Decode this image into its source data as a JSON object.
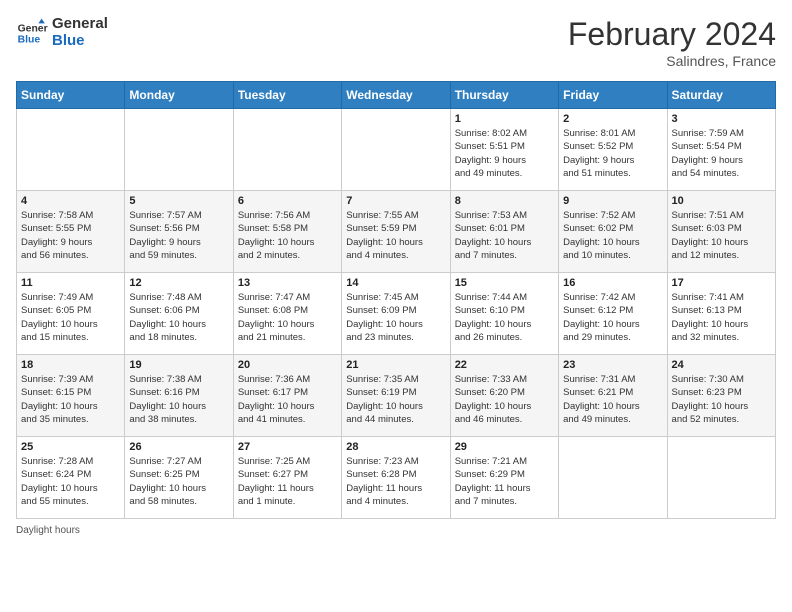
{
  "header": {
    "logo_line1": "General",
    "logo_line2": "Blue",
    "title": "February 2024",
    "location": "Salindres, France"
  },
  "days_of_week": [
    "Sunday",
    "Monday",
    "Tuesday",
    "Wednesday",
    "Thursday",
    "Friday",
    "Saturday"
  ],
  "weeks": [
    [
      {
        "day": "",
        "info": ""
      },
      {
        "day": "",
        "info": ""
      },
      {
        "day": "",
        "info": ""
      },
      {
        "day": "",
        "info": ""
      },
      {
        "day": "1",
        "info": "Sunrise: 8:02 AM\nSunset: 5:51 PM\nDaylight: 9 hours\nand 49 minutes."
      },
      {
        "day": "2",
        "info": "Sunrise: 8:01 AM\nSunset: 5:52 PM\nDaylight: 9 hours\nand 51 minutes."
      },
      {
        "day": "3",
        "info": "Sunrise: 7:59 AM\nSunset: 5:54 PM\nDaylight: 9 hours\nand 54 minutes."
      }
    ],
    [
      {
        "day": "4",
        "info": "Sunrise: 7:58 AM\nSunset: 5:55 PM\nDaylight: 9 hours\nand 56 minutes."
      },
      {
        "day": "5",
        "info": "Sunrise: 7:57 AM\nSunset: 5:56 PM\nDaylight: 9 hours\nand 59 minutes."
      },
      {
        "day": "6",
        "info": "Sunrise: 7:56 AM\nSunset: 5:58 PM\nDaylight: 10 hours\nand 2 minutes."
      },
      {
        "day": "7",
        "info": "Sunrise: 7:55 AM\nSunset: 5:59 PM\nDaylight: 10 hours\nand 4 minutes."
      },
      {
        "day": "8",
        "info": "Sunrise: 7:53 AM\nSunset: 6:01 PM\nDaylight: 10 hours\nand 7 minutes."
      },
      {
        "day": "9",
        "info": "Sunrise: 7:52 AM\nSunset: 6:02 PM\nDaylight: 10 hours\nand 10 minutes."
      },
      {
        "day": "10",
        "info": "Sunrise: 7:51 AM\nSunset: 6:03 PM\nDaylight: 10 hours\nand 12 minutes."
      }
    ],
    [
      {
        "day": "11",
        "info": "Sunrise: 7:49 AM\nSunset: 6:05 PM\nDaylight: 10 hours\nand 15 minutes."
      },
      {
        "day": "12",
        "info": "Sunrise: 7:48 AM\nSunset: 6:06 PM\nDaylight: 10 hours\nand 18 minutes."
      },
      {
        "day": "13",
        "info": "Sunrise: 7:47 AM\nSunset: 6:08 PM\nDaylight: 10 hours\nand 21 minutes."
      },
      {
        "day": "14",
        "info": "Sunrise: 7:45 AM\nSunset: 6:09 PM\nDaylight: 10 hours\nand 23 minutes."
      },
      {
        "day": "15",
        "info": "Sunrise: 7:44 AM\nSunset: 6:10 PM\nDaylight: 10 hours\nand 26 minutes."
      },
      {
        "day": "16",
        "info": "Sunrise: 7:42 AM\nSunset: 6:12 PM\nDaylight: 10 hours\nand 29 minutes."
      },
      {
        "day": "17",
        "info": "Sunrise: 7:41 AM\nSunset: 6:13 PM\nDaylight: 10 hours\nand 32 minutes."
      }
    ],
    [
      {
        "day": "18",
        "info": "Sunrise: 7:39 AM\nSunset: 6:15 PM\nDaylight: 10 hours\nand 35 minutes."
      },
      {
        "day": "19",
        "info": "Sunrise: 7:38 AM\nSunset: 6:16 PM\nDaylight: 10 hours\nand 38 minutes."
      },
      {
        "day": "20",
        "info": "Sunrise: 7:36 AM\nSunset: 6:17 PM\nDaylight: 10 hours\nand 41 minutes."
      },
      {
        "day": "21",
        "info": "Sunrise: 7:35 AM\nSunset: 6:19 PM\nDaylight: 10 hours\nand 44 minutes."
      },
      {
        "day": "22",
        "info": "Sunrise: 7:33 AM\nSunset: 6:20 PM\nDaylight: 10 hours\nand 46 minutes."
      },
      {
        "day": "23",
        "info": "Sunrise: 7:31 AM\nSunset: 6:21 PM\nDaylight: 10 hours\nand 49 minutes."
      },
      {
        "day": "24",
        "info": "Sunrise: 7:30 AM\nSunset: 6:23 PM\nDaylight: 10 hours\nand 52 minutes."
      }
    ],
    [
      {
        "day": "25",
        "info": "Sunrise: 7:28 AM\nSunset: 6:24 PM\nDaylight: 10 hours\nand 55 minutes."
      },
      {
        "day": "26",
        "info": "Sunrise: 7:27 AM\nSunset: 6:25 PM\nDaylight: 10 hours\nand 58 minutes."
      },
      {
        "day": "27",
        "info": "Sunrise: 7:25 AM\nSunset: 6:27 PM\nDaylight: 11 hours\nand 1 minute."
      },
      {
        "day": "28",
        "info": "Sunrise: 7:23 AM\nSunset: 6:28 PM\nDaylight: 11 hours\nand 4 minutes."
      },
      {
        "day": "29",
        "info": "Sunrise: 7:21 AM\nSunset: 6:29 PM\nDaylight: 11 hours\nand 7 minutes."
      },
      {
        "day": "",
        "info": ""
      },
      {
        "day": "",
        "info": ""
      }
    ]
  ],
  "footer": {
    "daylight_label": "Daylight hours"
  }
}
